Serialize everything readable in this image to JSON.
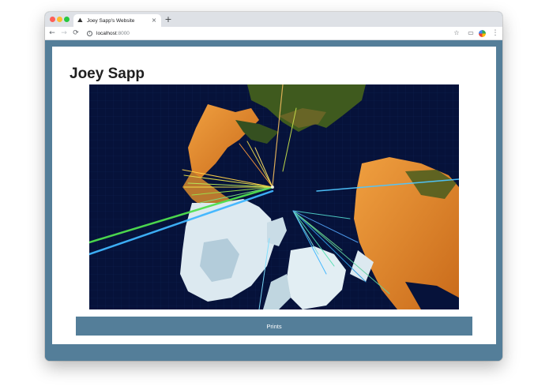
{
  "browser": {
    "tab": {
      "title": "Joey Sapp's Website",
      "favicon": "hiker-icon",
      "close_glyph": "×"
    },
    "new_tab_glyph": "+",
    "url": {
      "host": "localhost",
      "port": ":8000"
    },
    "nav": {
      "back": "←",
      "forward": "→",
      "reload": "⟳"
    },
    "icons": {
      "info": "i",
      "star": "☆",
      "cast": "▭",
      "menu": "⋮"
    }
  },
  "page": {
    "title": "Joey Sapp",
    "hero_image": "Map of the Arctic with colored connection lines radiating from a point near Greenland",
    "prints_button": "Prints"
  },
  "colors": {
    "page_bg": "#547e99",
    "card_bg": "#ffffff",
    "button_bg": "#547e99",
    "ocean": "#06123a",
    "land_orange": "#e8912e",
    "ice": "#dce9f0"
  }
}
